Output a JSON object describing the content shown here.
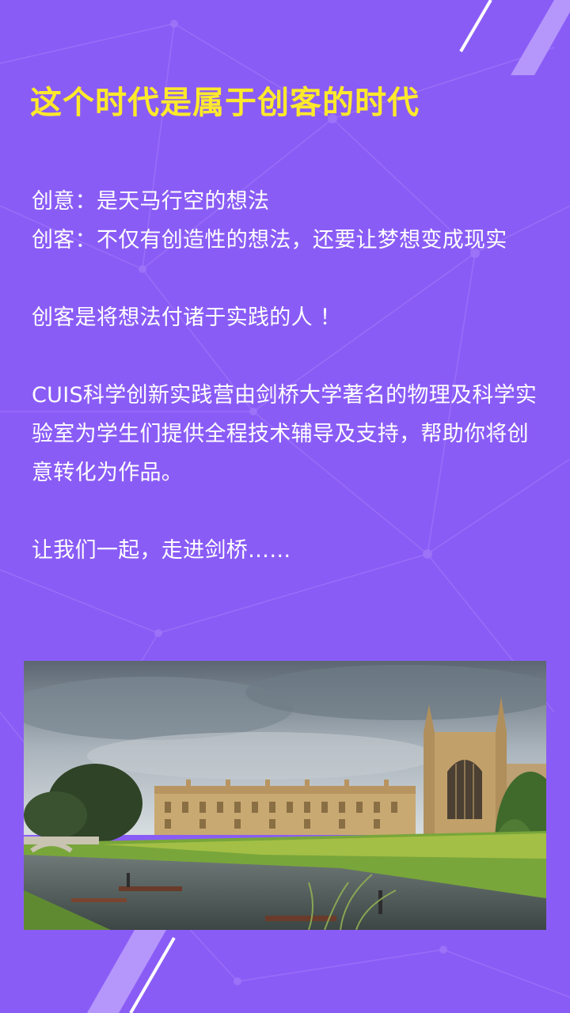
{
  "headline": "这个时代是属于创客的时代",
  "paragraphs": {
    "idea_line": "创意：是天马行空的想法",
    "maker_line": "创客：不仅有创造性的想法，还要让梦想变成现实",
    "maker_statement": "创客是将想法付诸于实践的人 ！",
    "program_description": "CUIS科学创新实践营由剑桥大学著名的物理及科学实验室为学生们提供全程技术辅导及支持，帮助你将创意转化为作品。",
    "closing": "让我们一起，走进剑桥……"
  },
  "colors": {
    "background": "#8a5cf6",
    "headline": "#fde92b",
    "body_text": "#ffffff"
  },
  "image": {
    "subject": "Cambridge King's College chapel and river Cam with punts"
  }
}
